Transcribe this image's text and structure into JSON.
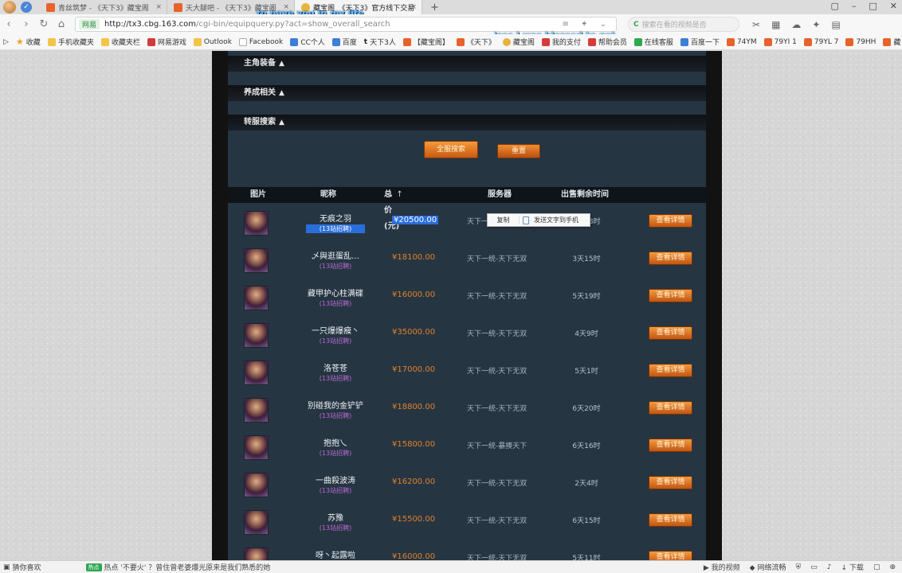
{
  "browser": {
    "tabs": [
      {
        "title": "青丝筑梦 - 《天下3》藏宝阁",
        "active": false
      },
      {
        "title": "天大腿吧 - 《天下3》藏宝阁",
        "active": false
      },
      {
        "title": "藏宝阁_《天下3》官方线下交易",
        "active": true
      }
    ],
    "new_tab": "+",
    "url_secure": "网易",
    "url_host": "http://tx3.cbg.163.com",
    "url_path": "/cgi-bin/equipquery.py?act=show_overall_search",
    "search_placeholder": "搜索在看的视频是否",
    "bookmarks": [
      "收藏",
      "手机收藏夹",
      "收藏夹栏",
      "网易游戏",
      "Outlook",
      "Facebook",
      "CC个人",
      "百度",
      "天下3人",
      "【藏宝阁】",
      "《天下》",
      "藏宝阁",
      "我的支付",
      "帮助会员",
      "在线客服",
      "百度一下",
      "74YM",
      "79YI 1",
      "79YL 7",
      "79HH",
      "藏"
    ]
  },
  "lyrics": {
    "line1": "to have you in my life",
    "line2": "'cos I was blessed to get"
  },
  "sections": {
    "main_equip": "主角装备",
    "cultivation": "养成相关",
    "transfer_search": "转服搜索"
  },
  "buttons": {
    "search": "全服搜索",
    "reset": "重置"
  },
  "table": {
    "headers": {
      "pic": "图片",
      "nick": "昵称",
      "price": "总价 (元)",
      "server": "服务器",
      "time": "出售剩余时间"
    },
    "detail_label": "查看详情",
    "rows": [
      {
        "nick": "无痕之羽",
        "sub": "(13站招聘)",
        "price": "¥20500.00",
        "server": "天下一统-天下无双",
        "time": "2天23时",
        "highlight": true
      },
      {
        "nick": "乄與逛蛋乱…",
        "sub": "(13站招聘)",
        "price": "¥18100.00",
        "server": "天下一统-天下无双",
        "time": "3天15时",
        "highlight": false
      },
      {
        "nick": "藏甲护心柱满碟",
        "sub": "(13站招聘)",
        "price": "¥16000.00",
        "server": "天下一统-天下无双",
        "time": "5天19时",
        "highlight": false
      },
      {
        "nick": "一只爆爆瘊丶",
        "sub": "(13站招聘)",
        "price": "¥35000.00",
        "server": "天下一统-天下无双",
        "time": "4天9时",
        "highlight": false
      },
      {
        "nick": "洛苍苍",
        "sub": "(13站招聘)",
        "price": "¥17000.00",
        "server": "天下一统-天下无双",
        "time": "5天1时",
        "highlight": false
      },
      {
        "nick": "别碰我的金铲铲",
        "sub": "(13站招聘)",
        "price": "¥18800.00",
        "server": "天下一统-天下无双",
        "time": "6天20时",
        "highlight": false
      },
      {
        "nick": "抱抱乀",
        "sub": "(13站招聘)",
        "price": "¥15800.00",
        "server": "天下一统-暴揍天下",
        "time": "6天16时",
        "highlight": false
      },
      {
        "nick": "一曲殺波涛",
        "sub": "(13站招聘)",
        "price": "¥16200.00",
        "server": "天下一统-天下无双",
        "time": "2天4时",
        "highlight": false
      },
      {
        "nick": "苏豫",
        "sub": "(13站招聘)",
        "price": "¥15500.00",
        "server": "天下一统-天下无双",
        "time": "6天15时",
        "highlight": false
      },
      {
        "nick": "呀丶起露啦",
        "sub": "(13站招聘)",
        "price": "¥16000.00",
        "server": "天下一统-天下无双",
        "time": "5天11时",
        "highlight": false
      }
    ]
  },
  "context_menu": {
    "item1": "复制",
    "item2": "发送文字到手机"
  },
  "statusbar": {
    "left_label": "猜你喜欢",
    "badge": "热点",
    "news": "热点 '不要火' ？曾住曾老婆爆光原来是我们熟悉的她",
    "video": "我的视频",
    "network": "网络流畅",
    "download": "下载"
  }
}
